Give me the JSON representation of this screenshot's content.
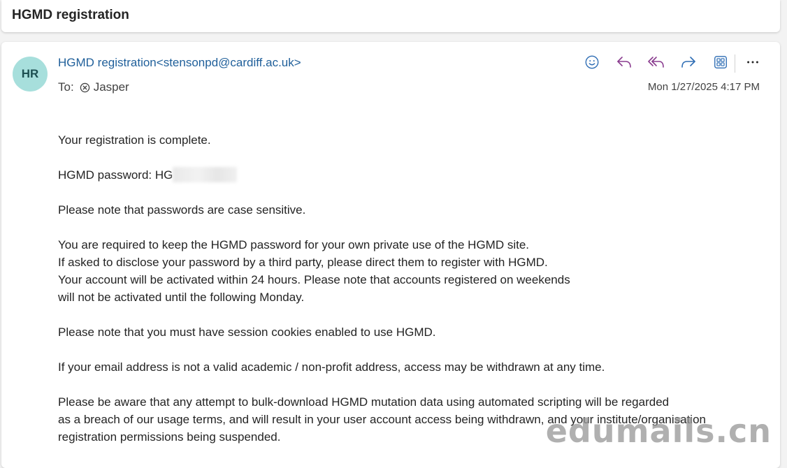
{
  "subject": "HGMD registration",
  "sender": {
    "initials": "HR",
    "name": "HGMD registration",
    "email": "<stensonpd@cardiff.ac.uk>"
  },
  "recipient": {
    "label": "To:",
    "name": "Jasper"
  },
  "timestamp": "Mon 1/27/2025 4:17 PM",
  "toolbar": {
    "emoji_icon": "smiley-icon",
    "reply_icon": "reply-icon",
    "reply_all_icon": "reply-all-icon",
    "forward_icon": "forward-icon",
    "apps_icon": "apps-icon",
    "more_icon": "more-icon"
  },
  "body": {
    "p1": "Your registration is complete.",
    "password_label": "HGMD password: HG",
    "p3": "Please note that passwords are case sensitive.",
    "p4_lines": [
      "You are required to keep the HGMD password for your own private use of the HGMD site.",
      "If asked to disclose your password by a third party, please direct them to register with HGMD.",
      "Your account will be activated within 24 hours. Please note that accounts registered on weekends",
      "will not be activated until the following Monday."
    ],
    "p5": "Please note that you must have session cookies enabled to use HGMD.",
    "p6": "If your email address is not a valid academic / non-profit address, access may be withdrawn at any time.",
    "p7_lines": [
      "Please be aware that any attempt to bulk-download HGMD mutation data using automated scripting will be regarded",
      "as a breach of our usage terms, and will result in your user account access being withdrawn, and your institute/organisation",
      "registration permissions being suspended."
    ]
  },
  "watermark": "edumails.cn",
  "colors": {
    "accent": "#1f5f9a",
    "avatar_bg": "#a7dfdc",
    "reply_all": "#8a3c8f",
    "toolbar_icon": "#2e6db4"
  }
}
